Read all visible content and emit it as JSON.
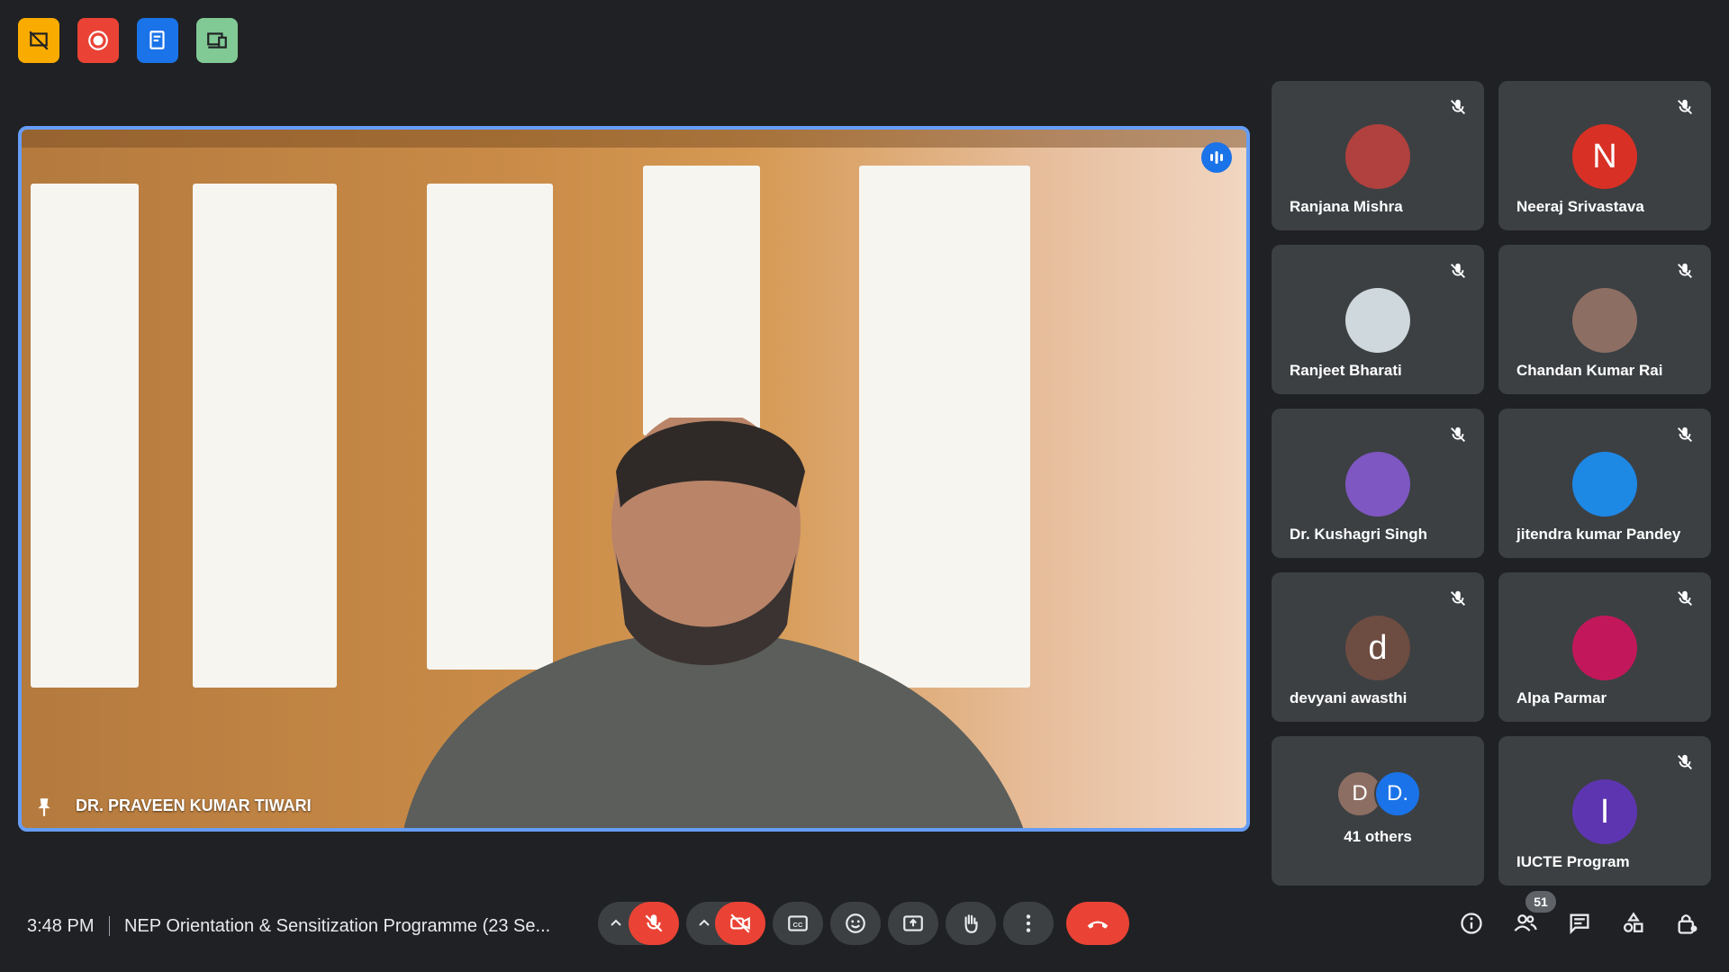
{
  "toolbar_top": [
    {
      "name": "presentation-off-icon",
      "color": "#f9ab00"
    },
    {
      "name": "record-icon",
      "color": "#ea4335"
    },
    {
      "name": "transcript-icon",
      "color": "#1a73e8"
    },
    {
      "name": "companion-icon",
      "color": "#81c995"
    }
  ],
  "main": {
    "speaker_name": "DR. PRAVEEN KUMAR TIWARI"
  },
  "participants": [
    {
      "name": "Ranjana Mishra",
      "initial": "",
      "avatar_color": "#b0413e"
    },
    {
      "name": "Neeraj Srivastava",
      "initial": "N",
      "avatar_color": "#d93025"
    },
    {
      "name": "Ranjeet Bharati",
      "initial": "",
      "avatar_color": "#cfd8dc"
    },
    {
      "name": "Chandan Kumar Rai",
      "initial": "",
      "avatar_color": "#8d6e63"
    },
    {
      "name": "Dr. Kushagri Singh",
      "initial": "",
      "avatar_color": "#7e57c2"
    },
    {
      "name": "jitendra kumar Pandey",
      "initial": "",
      "avatar_color": "#1e88e5"
    },
    {
      "name": "devyani awasthi",
      "initial": "d",
      "avatar_color": "#6d4c41"
    },
    {
      "name": "Alpa Parmar",
      "initial": "",
      "avatar_color": "#c2185b"
    },
    {
      "name": "IUCTE Program",
      "initial": "I",
      "avatar_color": "#5e35b1"
    }
  ],
  "others": {
    "label": "41 others",
    "a_initial": "D",
    "a_color": "#8d6e63",
    "b_initial": "D.",
    "b_color": "#1a73e8"
  },
  "bottom": {
    "time": "3:48 PM",
    "meeting_title": "NEP Orientation & Sensitization Programme (23 Se...",
    "participant_count": "51"
  }
}
